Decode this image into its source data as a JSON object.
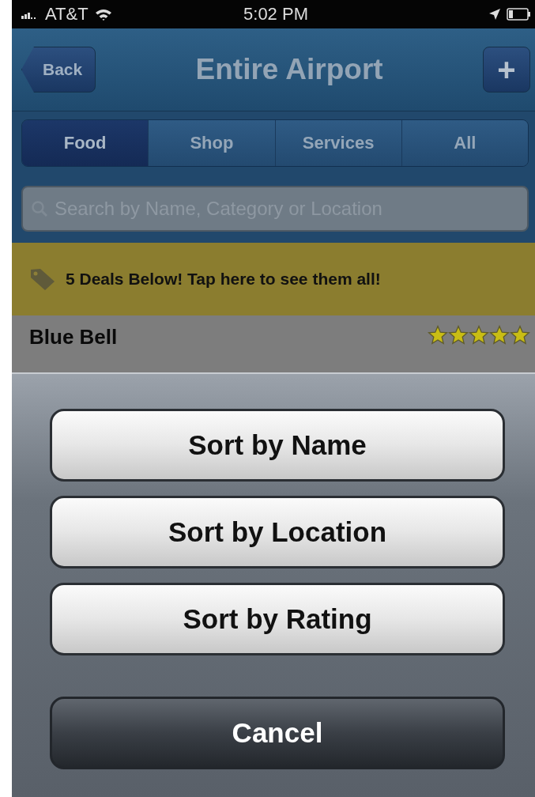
{
  "status_bar": {
    "carrier": "AT&T",
    "time": "5:02 PM"
  },
  "nav_bar": {
    "back": "Back",
    "title": "Entire Airport",
    "add": "+"
  },
  "tabs": [
    {
      "label": "Food",
      "selected": true
    },
    {
      "label": "Shop",
      "selected": false
    },
    {
      "label": "Services",
      "selected": false
    },
    {
      "label": "All",
      "selected": false
    }
  ],
  "search": {
    "placeholder": "Search by Name, Category or Location"
  },
  "deals_banner": "5 Deals Below! Tap here to see them all!",
  "list": [
    {
      "name": "Blue Bell",
      "stars": 5
    }
  ],
  "action_sheet": {
    "buttons": [
      {
        "label": "Sort by Name",
        "kind": "option"
      },
      {
        "label": "Sort by Location",
        "kind": "option"
      },
      {
        "label": "Sort by Rating",
        "kind": "option"
      },
      {
        "label": "Cancel",
        "kind": "cancel"
      }
    ]
  }
}
